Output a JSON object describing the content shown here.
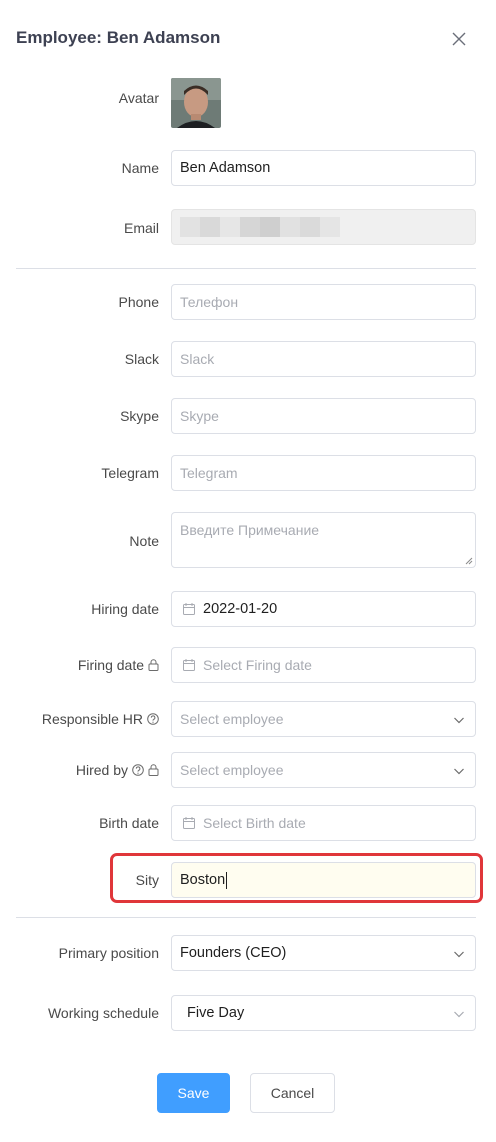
{
  "dialog": {
    "title": "Employee: Ben Adamson"
  },
  "fields": {
    "avatar": {
      "label": "Avatar"
    },
    "name": {
      "label": "Name",
      "value": "Ben Adamson"
    },
    "email": {
      "label": "Email"
    },
    "phone": {
      "label": "Phone",
      "placeholder": "Телефон"
    },
    "slack": {
      "label": "Slack",
      "placeholder": "Slack"
    },
    "skype": {
      "label": "Skype",
      "placeholder": "Skype"
    },
    "telegram": {
      "label": "Telegram",
      "placeholder": "Telegram"
    },
    "note": {
      "label": "Note",
      "placeholder": "Введите Примечание"
    },
    "hiring_date": {
      "label": "Hiring date",
      "value": "2022-01-20"
    },
    "firing_date": {
      "label": "Firing date",
      "placeholder": "Select Firing date"
    },
    "responsible_hr": {
      "label": "Responsible HR",
      "placeholder": "Select employee"
    },
    "hired_by": {
      "label": "Hired by",
      "placeholder": "Select employee"
    },
    "birth_date": {
      "label": "Birth date",
      "placeholder": "Select Birth date"
    },
    "city": {
      "label": "Sity",
      "value": "Boston"
    },
    "primary_position": {
      "label": "Primary position",
      "value": "Founders (CEO)"
    },
    "working_schedule": {
      "label": "Working schedule",
      "value": "Five Day"
    }
  },
  "buttons": {
    "save": "Save",
    "cancel": "Cancel"
  },
  "colors": {
    "primary": "#409eff",
    "highlight": "#e0363a",
    "city_bg": "#fffdf0"
  }
}
